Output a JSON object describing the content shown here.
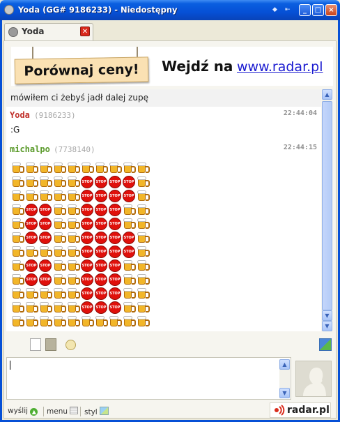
{
  "window": {
    "title": "Yoda (GG# 9186233) - Niedostępny"
  },
  "tab": {
    "label": "Yoda"
  },
  "banner": {
    "slogan": "Porównaj ceny!",
    "cta": "Wejdź na",
    "url": "www.radar.pl"
  },
  "messages": [
    {
      "text": "mówiłem ci żebyś jadł dalej zupę"
    },
    {
      "nick": "Yoda",
      "uid": "(9186233)",
      "time": "22:44:04",
      "text": ":G",
      "nick_color": "#c0302a"
    },
    {
      "nick": "michalpo",
      "uid": "(7738140)",
      "time": "22:44:15",
      "nick_color": "#5a9a2a",
      "emoticon_rows": [
        "BBBBBBBBBB",
        "BBBBBSSSSB",
        "BBBBBSSSSB",
        "BSSBBSSSBB",
        "BSSBBSSSBB",
        "BSSBBSSSSB",
        "BBBBBSSSSB",
        "BSSBBSSSBB",
        "BSSBBSSSBB",
        "BBBBBSSSBB",
        "BBBBBSSSBB",
        "BBBBBBBBBB"
      ],
      "emoticon_labels": {
        "stop": "STOP"
      }
    }
  ],
  "bottombar": {
    "send": "wyślij",
    "menu": "menu",
    "style": "styl"
  },
  "brand": {
    "name": "radar.pl"
  },
  "colors": {
    "titlebar": "#0650d6",
    "stop": "#e0100b",
    "beer": "#f2b629"
  }
}
